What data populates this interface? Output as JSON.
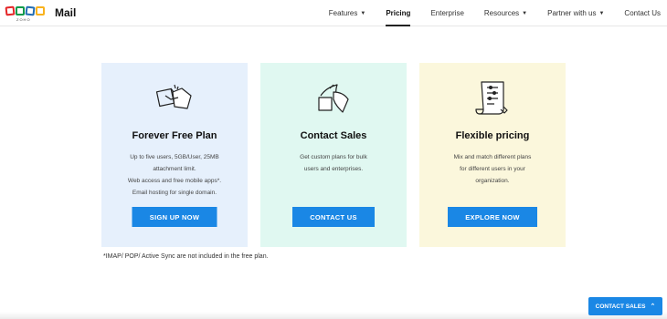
{
  "brand": {
    "logo_text": "ZOHO",
    "app_name": "Mail"
  },
  "nav": {
    "items": [
      {
        "label": "Features",
        "dropdown": true
      },
      {
        "label": "Pricing",
        "dropdown": false,
        "active": true
      },
      {
        "label": "Enterprise",
        "dropdown": false
      },
      {
        "label": "Resources",
        "dropdown": true
      },
      {
        "label": "Partner with us",
        "dropdown": true
      },
      {
        "label": "Contact Us",
        "dropdown": false
      }
    ]
  },
  "plans": [
    {
      "title": "Forever Free Plan",
      "lines": [
        "Up to five users, 5GB/User, 25MB",
        "attachment limit.",
        "Web access and free mobile apps*.",
        "Email hosting for single domain."
      ],
      "button": "SIGN UP NOW",
      "icon": "handshake-icon",
      "background": "#e6f0fc"
    },
    {
      "title": "Contact Sales",
      "lines": [
        "Get custom plans for bulk",
        "users and enterprises."
      ],
      "button": "CONTACT US",
      "icon": "paper-shapes-icon",
      "background": "#e0f8f1"
    },
    {
      "title": "Flexible pricing",
      "lines": [
        "Mix and match different plans",
        "for different users in your",
        "organization."
      ],
      "button": "EXPLORE NOW",
      "icon": "checklist-scroll-icon",
      "background": "#fbf7dc"
    }
  ],
  "footnote": "*IMAP/ POP/ Active Sync are not included in the free plan.",
  "contact_sales_float": "CONTACT SALES",
  "colors": {
    "accent": "#1a87e5",
    "logo": [
      "#e42527",
      "#089949",
      "#226db4",
      "#f9b21d"
    ]
  }
}
